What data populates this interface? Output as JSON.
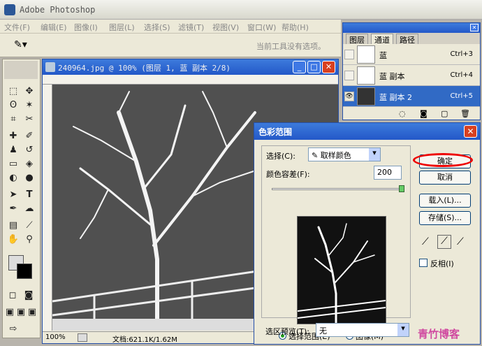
{
  "app": {
    "title": "Adobe Photoshop"
  },
  "menu": [
    "文件(F)",
    "编辑(E)",
    "图像(I)",
    "图层(L)",
    "选择(S)",
    "滤镜(T)",
    "视图(V)",
    "窗口(W)",
    "帮助(H)"
  ],
  "options": {
    "hint": "当前工具没有选项。"
  },
  "document": {
    "title": "240964.jpg @ 100% (图层 1, 蓝 副本 2/8)",
    "zoom": "100%",
    "status": "文档:621.1K/1.62M"
  },
  "channels": {
    "tabs": [
      "图层",
      "通道",
      "路径"
    ],
    "rows": [
      {
        "name": "蓝",
        "shortcut": "Ctrl+3"
      },
      {
        "name": "蓝 副本",
        "shortcut": "Ctrl+4"
      },
      {
        "name": "蓝 副本 2",
        "shortcut": "Ctrl+5"
      }
    ]
  },
  "dialog": {
    "title": "色彩范围",
    "select_label": "选择(C):",
    "select_value": "取样颜色",
    "fuzz_label": "颜色容差(F):",
    "fuzz_value": "200",
    "fuzziness": 200,
    "fuzziness_max": 200,
    "radio_selection": "选择范围(E)",
    "radio_image": "图像(M)",
    "preview_label": "选区预览(T):",
    "preview_value": "无",
    "ok": "确定",
    "cancel": "取消",
    "load": "载入(L)...",
    "save": "存储(S)...",
    "invert": "反相(I)"
  },
  "watermark": "青竹博客"
}
